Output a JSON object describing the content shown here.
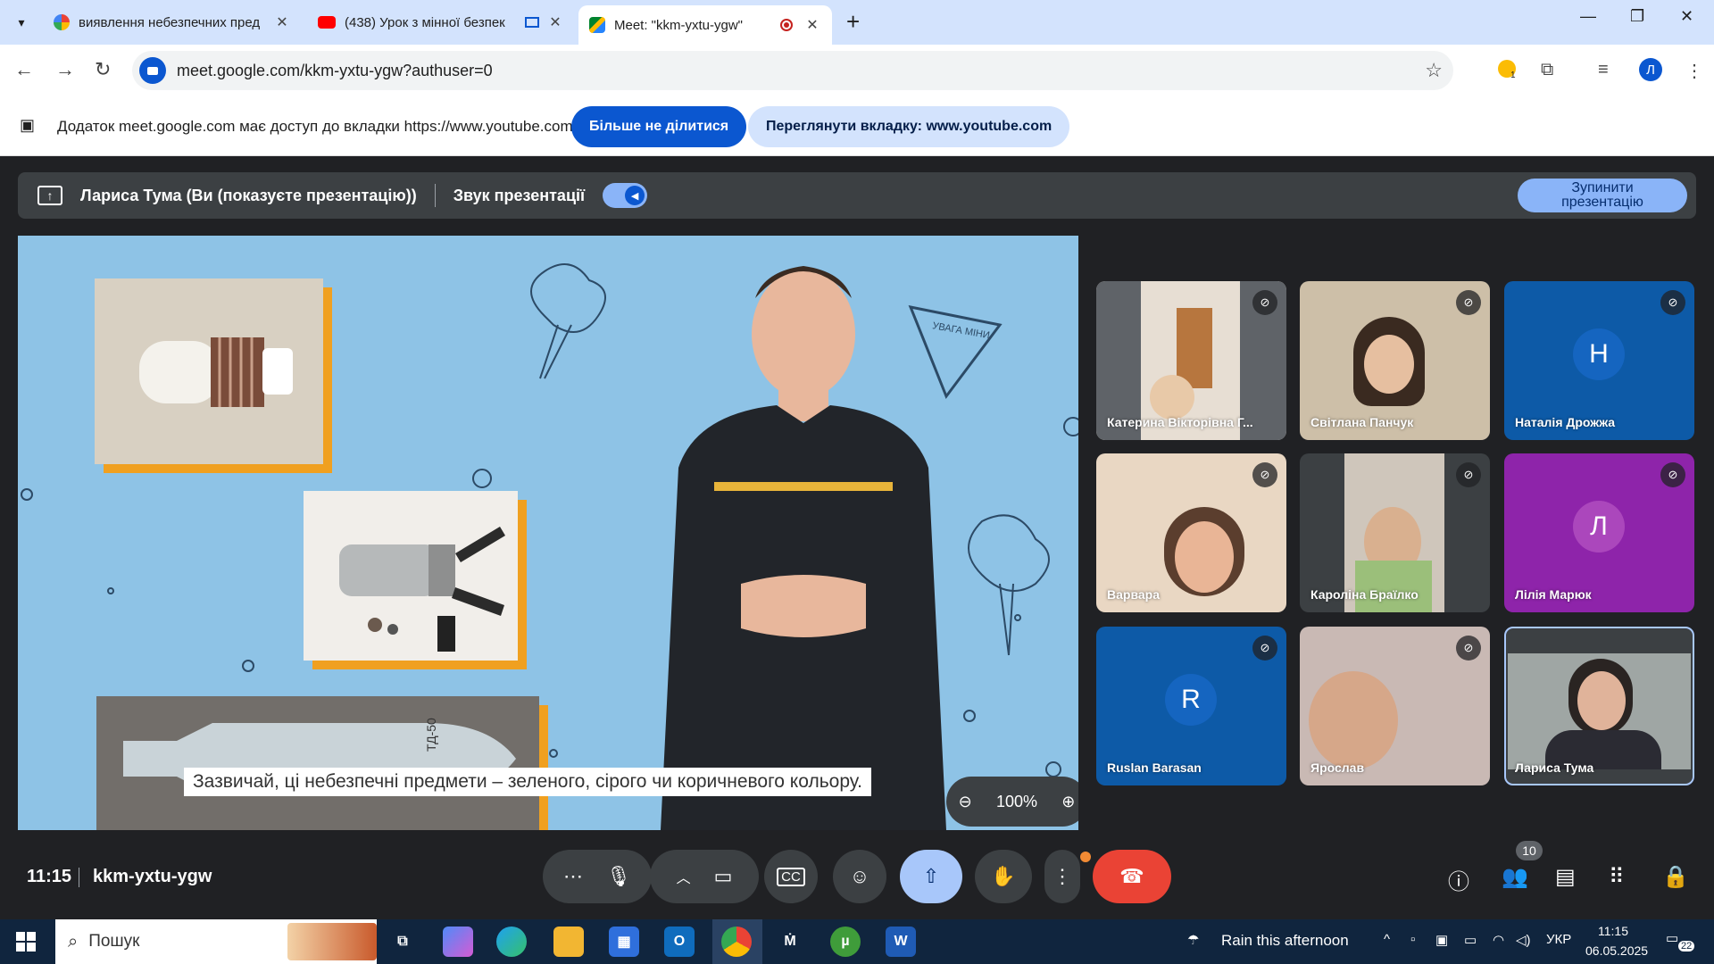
{
  "browser": {
    "tabs": [
      {
        "title": "виявлення небезпечних пред",
        "favicon": "google-icon",
        "active": false
      },
      {
        "title": "(438) Урок з мінної безпек",
        "favicon": "youtube-icon",
        "active": false
      },
      {
        "title": "Meet: \"kkm-yxtu-ygw\"",
        "favicon": "meet-icon",
        "active": true
      }
    ],
    "url": "meet.google.com/kkm-yxtu-ygw?authuser=0",
    "profile_initial": "Л",
    "extension_badge": "1"
  },
  "infobar": {
    "message": "Додаток meet.google.com має доступ до вкладки https://www.youtube.com",
    "stop_sharing_label": "Більше не ділитися",
    "view_tab_label": "Переглянути вкладку: www.youtube.com"
  },
  "presenting": {
    "presenter_label": "Лариса Тума (Ви (показуєте презентацію))",
    "audio_label": "Звук презентації",
    "stop_label": "Зупинити презентацію"
  },
  "presentation": {
    "caption": "Зазвичай, ці небезпечні предмети – зеленого, сірого чи коричневого кольору.",
    "zoom": "100%",
    "sign_text": "УВАГА МІНИ"
  },
  "participants": [
    {
      "name": "Катерина Вікторівна Г...",
      "initial": "",
      "muted": true
    },
    {
      "name": "Світлана Панчук",
      "initial": "",
      "muted": true
    },
    {
      "name": "Наталія Дрожжа",
      "initial": "Н",
      "muted": true
    },
    {
      "name": "Варвара",
      "initial": "",
      "muted": true
    },
    {
      "name": "Кароліна Браїлко",
      "initial": "",
      "muted": true
    },
    {
      "name": "Лілія Марюк",
      "initial": "Л",
      "muted": true
    },
    {
      "name": "Ruslan Barasan",
      "initial": "R",
      "muted": true
    },
    {
      "name": "Ярослав",
      "initial": "",
      "muted": true
    },
    {
      "name": "Лариса Тума",
      "initial": "",
      "muted": false
    }
  ],
  "meeting": {
    "time": "11:15",
    "code": "kkm-yxtu-ygw",
    "participant_count": "10"
  },
  "taskbar": {
    "search_placeholder": "Пошук",
    "weather": "Rain this afternoon",
    "language": "УКР",
    "clock_time": "11:15",
    "clock_date": "06.05.2025",
    "notifications": "22"
  },
  "colors": {
    "meet_bg": "#202124",
    "accent_blue": "#0b57d0",
    "end_call_red": "#ea4335",
    "slide_bg": "#8ec3e6"
  }
}
